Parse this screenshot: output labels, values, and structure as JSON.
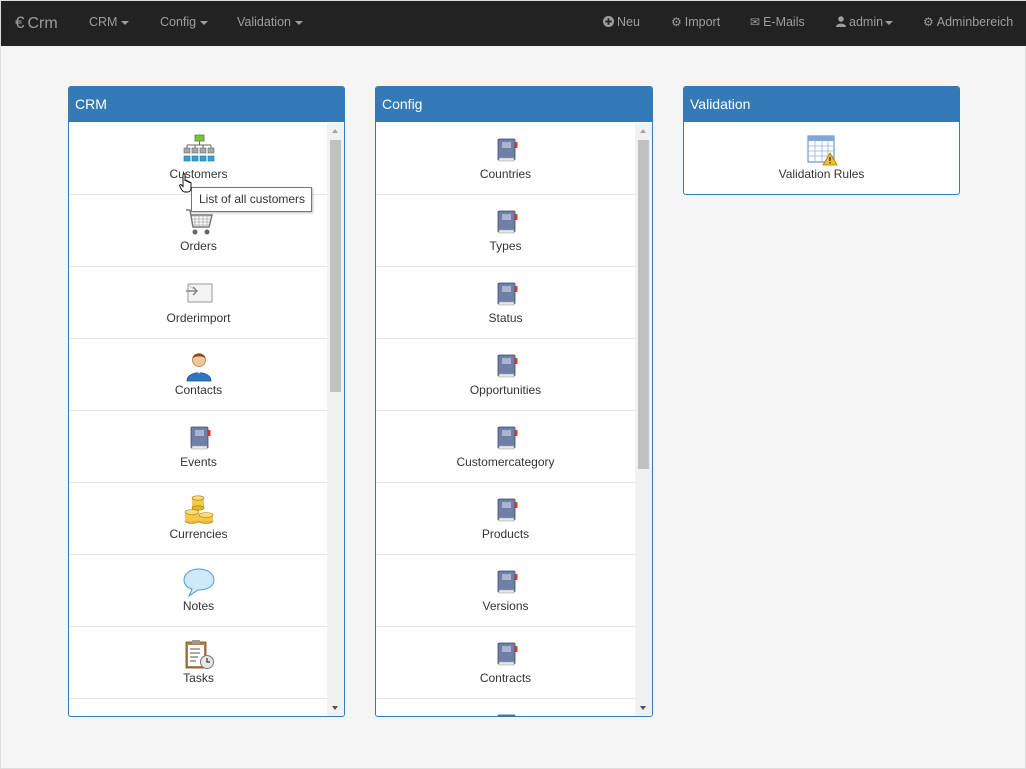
{
  "navbar": {
    "brand": "Crm",
    "menus": [
      {
        "label": "CRM"
      },
      {
        "label": "Config"
      },
      {
        "label": "Validation"
      }
    ],
    "actions": [
      {
        "label": "Neu",
        "icon": "plus-circle-icon"
      },
      {
        "label": "Import",
        "icon": "gear-icon"
      },
      {
        "label": "E-Mails",
        "icon": "envelope-icon"
      },
      {
        "label": "admin",
        "icon": "user-icon"
      },
      {
        "label": "Adminbereich",
        "icon": "gear-icon"
      }
    ]
  },
  "crm_panel": {
    "title": "CRM",
    "items": [
      {
        "label": "Customers",
        "icon": "org-chart-icon"
      },
      {
        "label": "Orders",
        "icon": "shopping-cart-icon"
      },
      {
        "label": "Orderimport",
        "icon": "import-icon"
      },
      {
        "label": "Contacts",
        "icon": "person-icon"
      },
      {
        "label": "Events",
        "icon": "book-icon"
      },
      {
        "label": "Currencies",
        "icon": "coins-icon"
      },
      {
        "label": "Notes",
        "icon": "speech-bubble-icon"
      },
      {
        "label": "Tasks",
        "icon": "clipboard-clock-icon"
      }
    ]
  },
  "config_panel": {
    "title": "Config",
    "items": [
      {
        "label": "Countries",
        "icon": "book-icon"
      },
      {
        "label": "Types",
        "icon": "book-icon"
      },
      {
        "label": "Status",
        "icon": "book-icon"
      },
      {
        "label": "Opportunities",
        "icon": "book-icon"
      },
      {
        "label": "Customercategory",
        "icon": "book-icon"
      },
      {
        "label": "Products",
        "icon": "book-icon"
      },
      {
        "label": "Versions",
        "icon": "book-icon"
      },
      {
        "label": "Contracts",
        "icon": "book-icon"
      }
    ]
  },
  "validation_panel": {
    "title": "Validation",
    "items": [
      {
        "label": "Validation Rules",
        "icon": "table-warning-icon"
      }
    ]
  },
  "tooltip": {
    "text": "List of all customers"
  },
  "colors": {
    "navbar": "#222222",
    "panel_primary": "#337ab7",
    "background": "#f5f5f5"
  }
}
